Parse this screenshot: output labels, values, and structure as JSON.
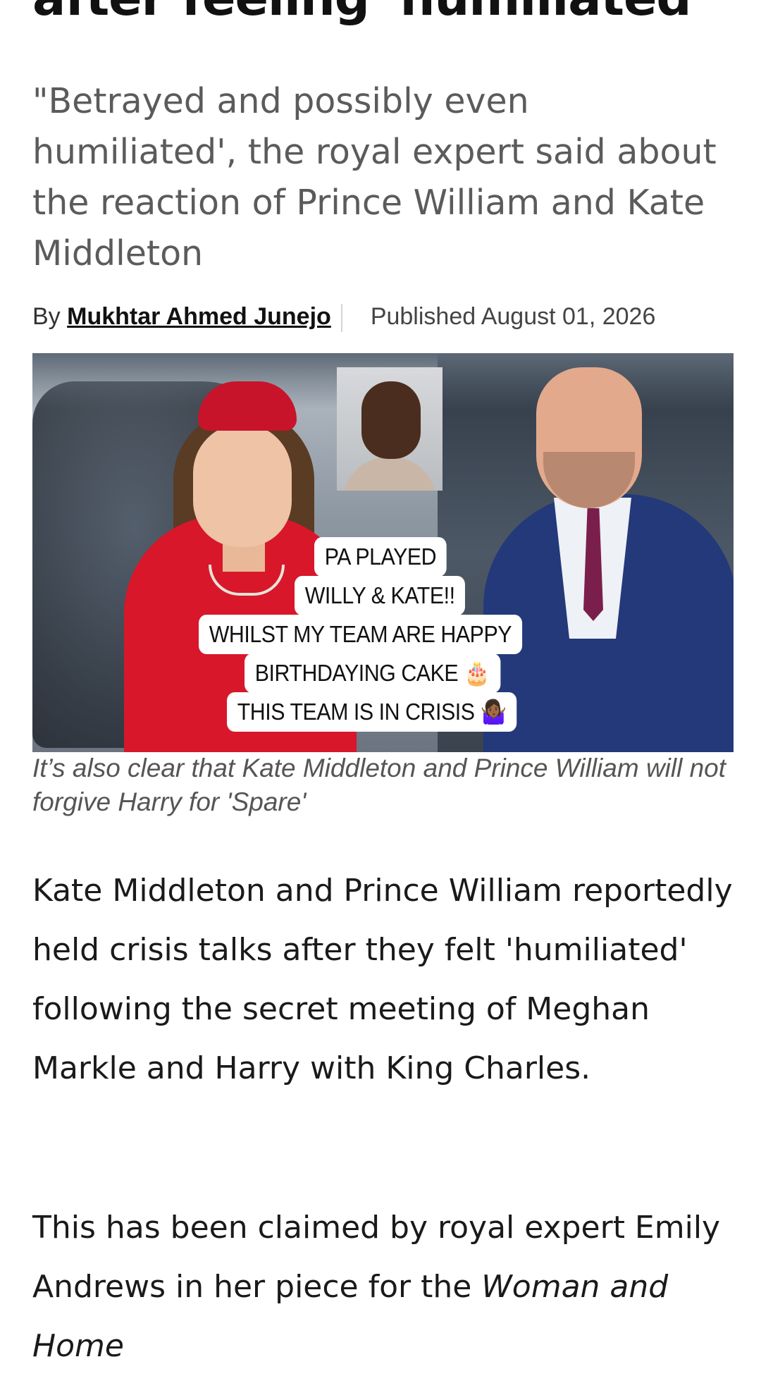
{
  "article": {
    "headline_fragment": "after feeling 'humiliated'",
    "subheadline": "\"Betrayed and possibly even humiliated', the royal expert said about the reaction of Prince William and Kate Middleton",
    "byline": {
      "by_label": "By",
      "author": "Mukhtar Ahmed Junejo",
      "published": "Published August 01, 2026"
    },
    "image": {
      "caption": "It’s also clear that Kate Middleton and Prince William will not forgive Harry for 'Spare'"
    },
    "paragraphs": [
      "Kate Middleton and Prince William reportedly held crisis talks after they felt 'humiliated' following the secret meeting of Meghan Markle and Harry with King Charles."
    ],
    "paragraph2": {
      "text": "This has been claimed by royal expert Emily Andrews in her piece for the ",
      "italic": "Woman and Home"
    }
  },
  "overlay_caption": {
    "lines": [
      "PA PLAYED",
      "WILLY & KATE!!",
      "WHILST MY TEAM ARE HAPPY",
      "BIRTHDAYING CAKE 🎂",
      "THIS TEAM IS IN CRISIS 🤷🏾‍♀️"
    ]
  },
  "colors": {
    "headline": "#111111",
    "subheadline": "#5b5b5b",
    "caption": "#555555",
    "body": "#1a1a1a"
  }
}
